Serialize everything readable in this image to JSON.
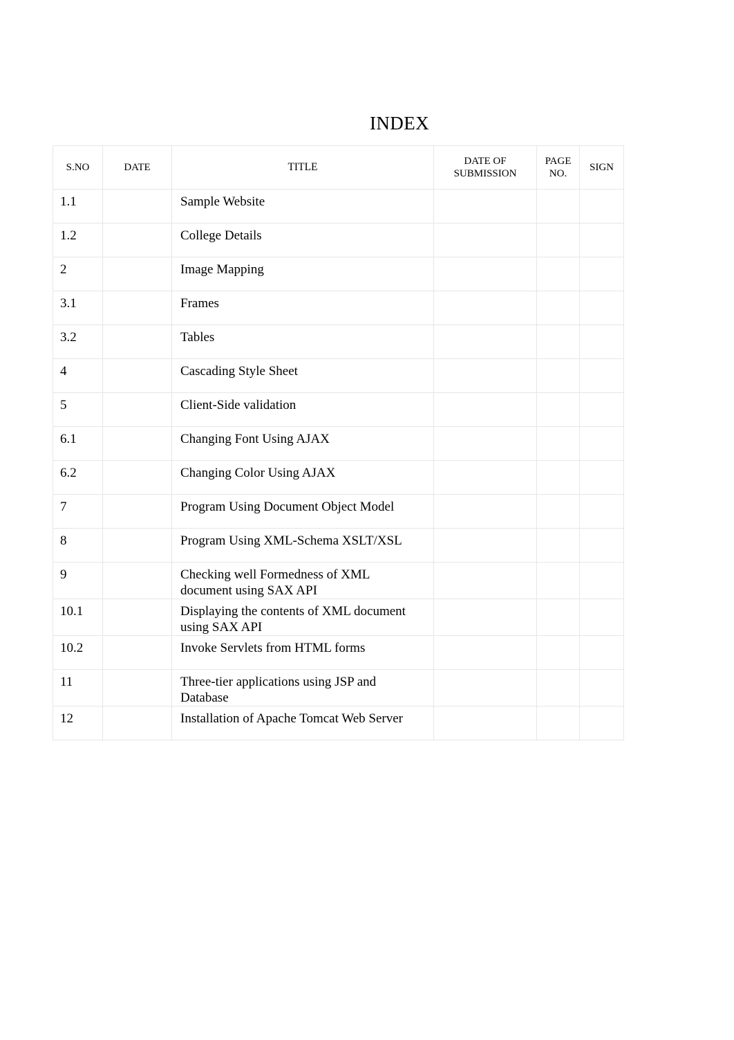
{
  "document": {
    "title": "INDEX",
    "background_color": "#ffffff",
    "text_color": "#000000",
    "border_color": "#e6e6e6"
  },
  "table": {
    "columns": [
      {
        "key": "sno",
        "label": "S.NO"
      },
      {
        "key": "date",
        "label": "DATE"
      },
      {
        "key": "title",
        "label": "TITLE"
      },
      {
        "key": "dos",
        "label": "DATE OF\nSUBMISSION"
      },
      {
        "key": "page",
        "label": "PAGE\nNO."
      },
      {
        "key": "sign",
        "label": "SIGN"
      }
    ],
    "rows": [
      {
        "sno": "1.1",
        "date": "",
        "title": "Sample Website",
        "dos": "",
        "page": "",
        "sign": ""
      },
      {
        "sno": "1.2",
        "date": "",
        "title": "College Details",
        "dos": "",
        "page": "",
        "sign": ""
      },
      {
        "sno": "2",
        "date": "",
        "title": "Image Mapping",
        "dos": "",
        "page": "",
        "sign": ""
      },
      {
        "sno": "3.1",
        "date": "",
        "title": "Frames",
        "dos": "",
        "page": "",
        "sign": ""
      },
      {
        "sno": "3.2",
        "date": "",
        "title": "Tables",
        "dos": "",
        "page": "",
        "sign": ""
      },
      {
        "sno": "4",
        "date": "",
        "title": "Cascading Style Sheet",
        "dos": "",
        "page": "",
        "sign": ""
      },
      {
        "sno": "5",
        "date": "",
        "title": "Client-Side validation",
        "dos": "",
        "page": "",
        "sign": ""
      },
      {
        "sno": "6.1",
        "date": "",
        "title": "Changing Font Using AJAX",
        "dos": "",
        "page": "",
        "sign": ""
      },
      {
        "sno": "6.2",
        "date": "",
        "title": "Changing Color Using AJAX",
        "dos": "",
        "page": "",
        "sign": ""
      },
      {
        "sno": "7",
        "date": "",
        "title": "Program Using Document Object Model",
        "dos": "",
        "page": "",
        "sign": ""
      },
      {
        "sno": "8",
        "date": "",
        "title": "Program Using XML-Schema XSLT/XSL",
        "dos": "",
        "page": "",
        "sign": ""
      },
      {
        "sno": "9",
        "date": "",
        "title": "Checking well Formedness of XML\ndocument using SAX API",
        "dos": "",
        "page": "",
        "sign": ""
      },
      {
        "sno": "10.1",
        "date": "",
        "title": "Displaying the contents of XML document\nusing SAX API",
        "dos": "",
        "page": "",
        "sign": ""
      },
      {
        "sno": "10.2",
        "date": "",
        "title": "Invoke Servlets from HTML forms",
        "dos": "",
        "page": "",
        "sign": ""
      },
      {
        "sno": "11",
        "date": "",
        "title": "Three-tier applications using JSP and\nDatabase",
        "dos": "",
        "page": "",
        "sign": ""
      },
      {
        "sno": "12",
        "date": "",
        "title": "Installation of Apache Tomcat Web Server",
        "dos": "",
        "page": "",
        "sign": ""
      }
    ],
    "row_styles": [
      "single",
      "single",
      "single",
      "single",
      "single",
      "single",
      "single",
      "single",
      "single",
      "single",
      "single",
      "double",
      "double",
      "single",
      "double",
      "single"
    ]
  }
}
